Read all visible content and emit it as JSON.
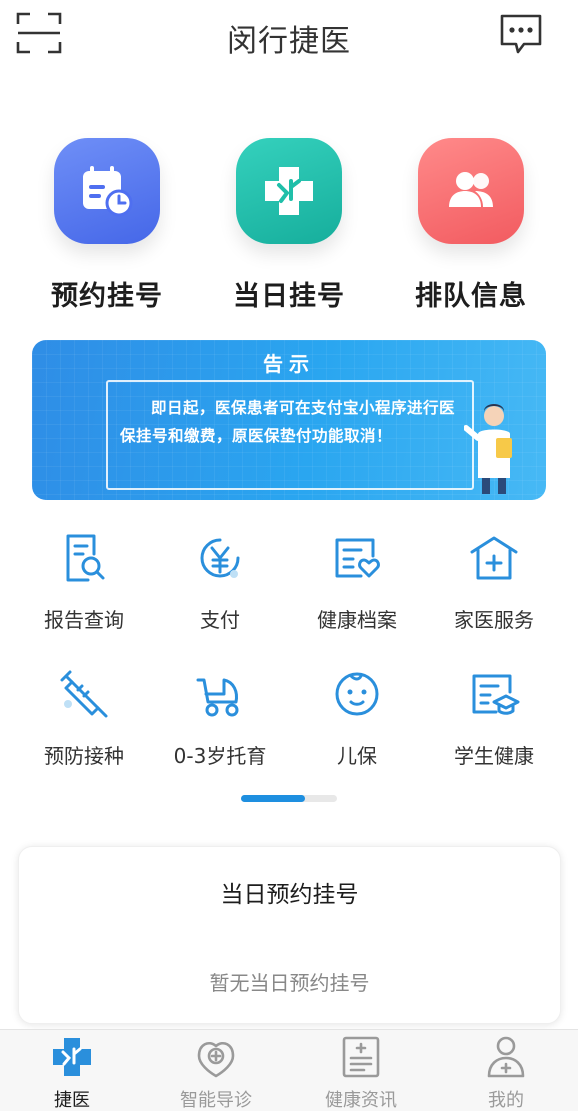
{
  "header": {
    "title": "闵行捷医",
    "scan_icon": "scan-icon",
    "message_icon": "message-icon"
  },
  "quick_actions": [
    {
      "label": "预约挂号",
      "icon": "calendar-clock-icon",
      "color": "#4f6ff0"
    },
    {
      "label": "当日挂号",
      "icon": "medical-cross-icon",
      "color": "#1fbfa9"
    },
    {
      "label": "排队信息",
      "icon": "users-icon",
      "color": "#f4676b"
    }
  ],
  "banner": {
    "title": "告示",
    "text": "即日起，医保患者可在支付宝小程序进行医保挂号和缴费，原医保垫付功能取消！"
  },
  "services": [
    {
      "label": "报告查询",
      "icon": "report-search-icon"
    },
    {
      "label": "支付",
      "icon": "yuan-pay-icon"
    },
    {
      "label": "健康档案",
      "icon": "health-record-icon"
    },
    {
      "label": "家医服务",
      "icon": "family-doctor-icon"
    },
    {
      "label": "预防接种",
      "icon": "vaccine-syringe-icon"
    },
    {
      "label": "0-3岁托育",
      "icon": "stroller-icon"
    },
    {
      "label": "儿保",
      "icon": "baby-face-icon"
    },
    {
      "label": "学生健康",
      "icon": "student-health-icon"
    }
  ],
  "pager": {
    "active_page": 1,
    "pages": 2
  },
  "today_card": {
    "title": "当日预约挂号",
    "empty_text": "暂无当日预约挂号"
  },
  "tabbar": [
    {
      "label": "捷医",
      "icon": "jieyi-icon",
      "active": true
    },
    {
      "label": "智能导诊",
      "icon": "smart-guide-icon",
      "active": false
    },
    {
      "label": "健康资讯",
      "icon": "health-news-icon",
      "active": false
    },
    {
      "label": "我的",
      "icon": "profile-icon",
      "active": false
    }
  ],
  "colors": {
    "accent": "#1e8fe0",
    "icon_blue": "#2a8fdc"
  }
}
